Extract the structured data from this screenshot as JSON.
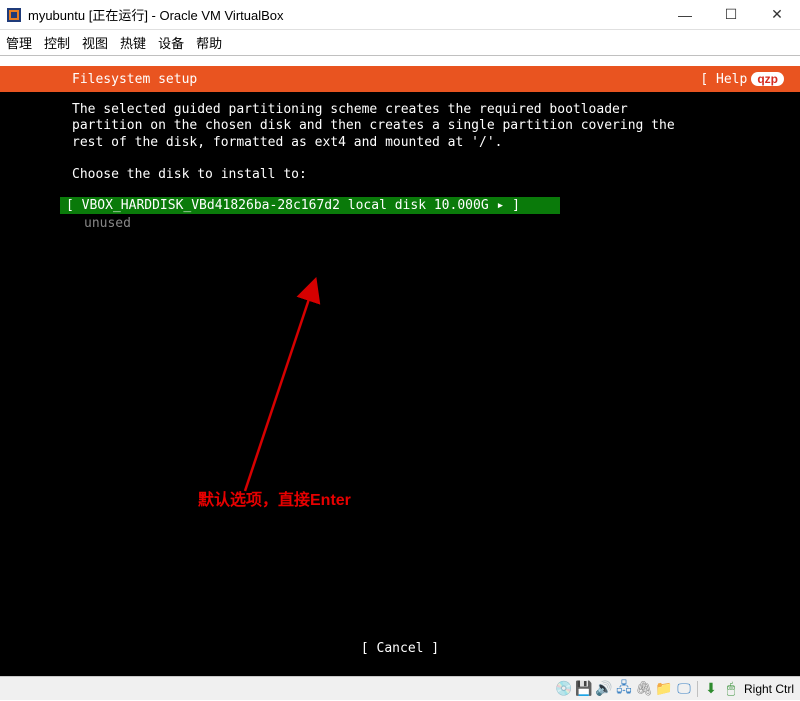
{
  "window": {
    "title": "myubuntu [正在运行] - Oracle VM VirtualBox",
    "controls": {
      "min": "—",
      "max": "☐",
      "close": "✕"
    }
  },
  "menu": {
    "items": [
      "管理",
      "控制",
      "视图",
      "热键",
      "设备",
      "帮助"
    ]
  },
  "installer": {
    "header_title": "Filesystem setup",
    "help_label": "[ Help",
    "watermark": "qzp",
    "body_text": "The selected guided partitioning scheme creates the required bootloader\npartition on the chosen disk and then creates a single partition covering the\nrest of the disk, formatted as ext4 and mounted at '/'.",
    "choose_prompt": "Choose the disk to install to:",
    "disk": {
      "line": "[ VBOX_HARDDISK_VBd41826ba-28c167d2  local disk    10.000G   ▸ ]",
      "unused": "unused"
    },
    "cancel": "[ Cancel     ]"
  },
  "annotation": {
    "text": "默认选项，直接Enter"
  },
  "statusbar": {
    "host_key": "Right Ctrl"
  },
  "icons": {
    "optical": "💿",
    "disk": "💾",
    "audio": "🔊",
    "network": "🖧",
    "usb": "🖇",
    "shared": "📁",
    "display": "🖵",
    "ga": "⬇",
    "capture": "🖱"
  }
}
